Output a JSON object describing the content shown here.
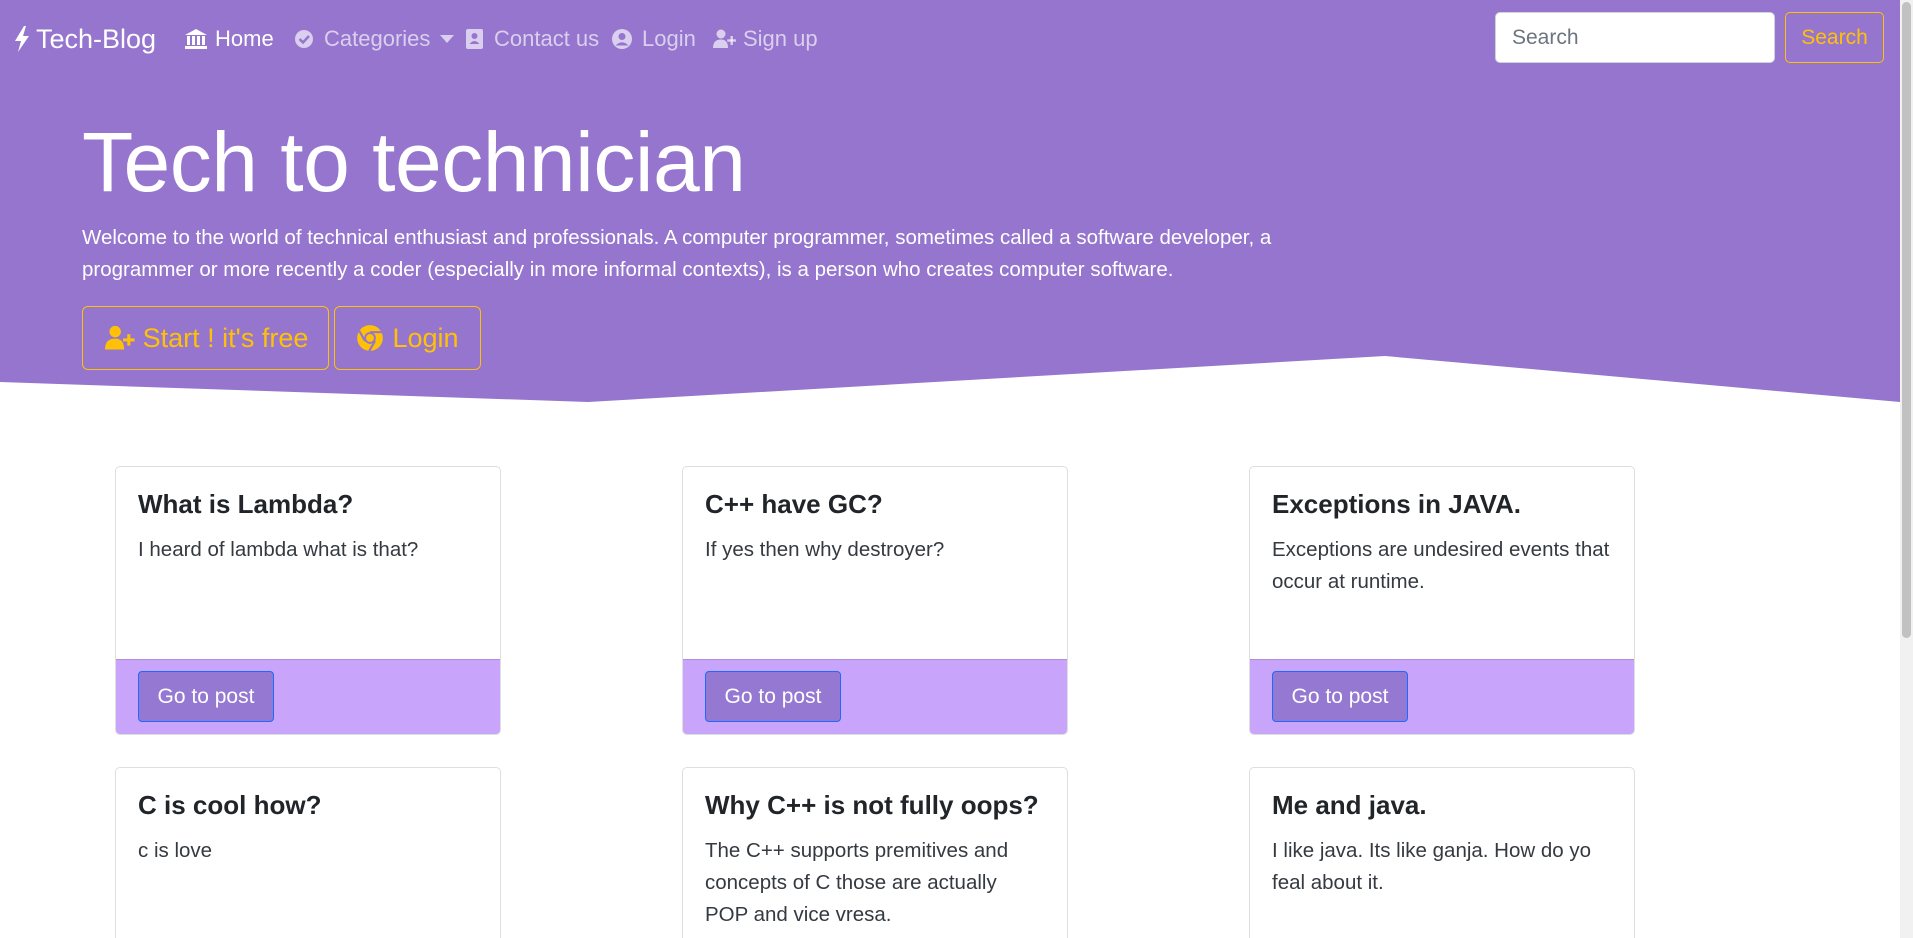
{
  "colors": {
    "hero": "#9575cd",
    "accent": "#ffc107",
    "card_footer": "#c8a5fb",
    "post_button": "#9578d1"
  },
  "navbar": {
    "brand": "Tech-Blog",
    "brand_icon": "bolt-icon",
    "items": [
      {
        "label": "Home",
        "icon": "bank-icon",
        "active": true
      },
      {
        "label": "Categories",
        "icon": "check-circle-icon",
        "dropdown": true
      },
      {
        "label": "Contact us",
        "icon": "address-book-icon"
      },
      {
        "label": "Login",
        "icon": "user-circle-icon"
      },
      {
        "label": "Sign up",
        "icon": "user-plus-icon"
      }
    ],
    "search_placeholder": "Search",
    "search_button": "Search"
  },
  "hero": {
    "title": "Tech to technician",
    "lead": "Welcome to the world of technical enthusiast and professionals. A computer programmer, sometimes called a software developer, a programmer or more recently a coder (especially in more informal contexts), is a person who creates computer software.",
    "start_button": "Start ! it's free",
    "start_icon": "user-plus-icon",
    "login_button": "Login",
    "login_icon": "chrome-icon"
  },
  "posts": [
    {
      "title": "What is Lambda?",
      "text": "I heard of lambda what is that?",
      "button": "Go to post"
    },
    {
      "title": "C++ have GC?",
      "text": "If yes then why destroyer?",
      "button": "Go to post"
    },
    {
      "title": "Exceptions in JAVA.",
      "text": "Exceptions are undesired events that occur at runtime.",
      "button": "Go to post"
    },
    {
      "title": "C is cool how?",
      "text": "c is love"
    },
    {
      "title": "Why C++ is not fully oops?",
      "text": "The C++ supports premitives and concepts of C those are actually POP and vice vresa."
    },
    {
      "title": "Me and java.",
      "text": "I like java. Its like ganja. How do yo feal about it."
    }
  ]
}
